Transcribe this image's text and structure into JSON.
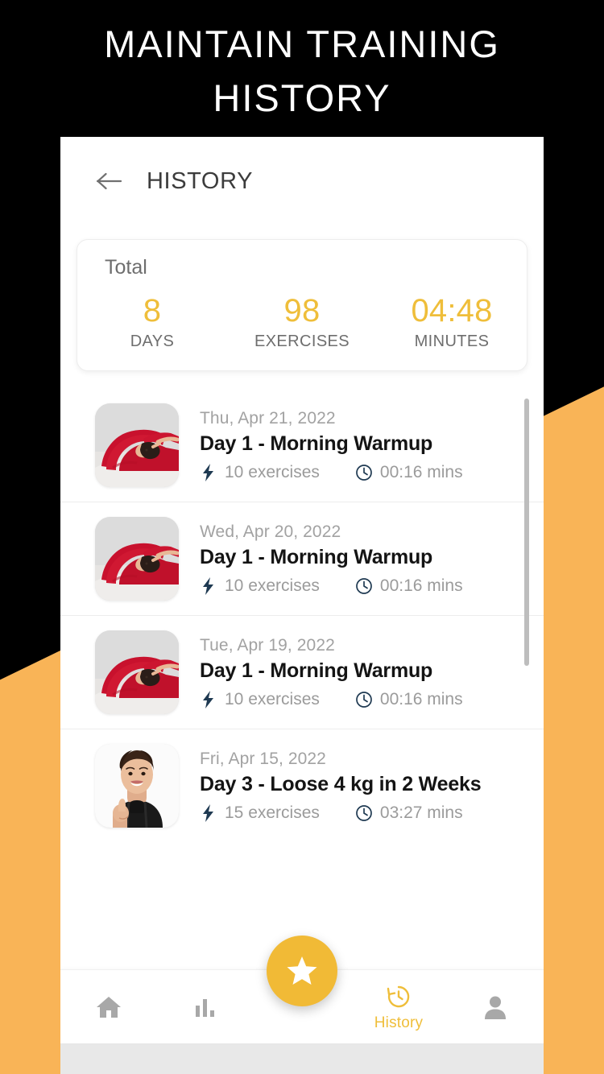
{
  "promo": {
    "headline": "MAINTAIN TRAINING\nHISTORY",
    "background_color": "#000000",
    "accent_color": "#F9B457"
  },
  "theme": {
    "amber": "#EFBE3A",
    "fab": "#F1BA36",
    "icon_navy": "#1F3A52",
    "muted_text": "#9B9B9B"
  },
  "appbar": {
    "back_icon": "arrow-left-icon",
    "title": "HISTORY"
  },
  "total_card": {
    "label": "Total",
    "stats": [
      {
        "value": "8",
        "unit": "DAYS"
      },
      {
        "value": "98",
        "unit": "EXERCISES"
      },
      {
        "value": "04:48",
        "unit": "MINUTES"
      }
    ]
  },
  "history": {
    "rows": [
      {
        "date": "Thu, Apr 21, 2022",
        "title": "Day 1 - Morning Warmup",
        "exercises": "10 exercises",
        "duration": "00:16 mins",
        "thumb": "woman-side-stretch-red",
        "exercises_icon": "lightning-bolt-icon",
        "duration_icon": "clock-icon"
      },
      {
        "date": "Wed, Apr 20, 2022",
        "title": "Day 1 - Morning Warmup",
        "exercises": "10 exercises",
        "duration": "00:16 mins",
        "thumb": "woman-side-stretch-red",
        "exercises_icon": "lightning-bolt-icon",
        "duration_icon": "clock-icon"
      },
      {
        "date": "Tue, Apr 19, 2022",
        "title": "Day 1 - Morning Warmup",
        "exercises": "10 exercises",
        "duration": "00:16 mins",
        "thumb": "woman-side-stretch-red",
        "exercises_icon": "lightning-bolt-icon",
        "duration_icon": "clock-icon"
      },
      {
        "date": "Fri, Apr 15, 2022",
        "title": "Day 3 - Loose 4 kg in 2 Weeks",
        "exercises": "15 exercises",
        "duration": "03:27 mins",
        "thumb": "woman-thumbs-up",
        "exercises_icon": "lightning-bolt-icon",
        "duration_icon": "clock-icon"
      }
    ]
  },
  "bottom_nav": {
    "items": [
      {
        "icon": "home-icon",
        "label": "",
        "active": false
      },
      {
        "icon": "bar-chart-icon",
        "label": "",
        "active": false
      },
      {
        "icon": "history-icon",
        "label": "History",
        "active": true
      },
      {
        "icon": "person-icon",
        "label": "",
        "active": false
      }
    ],
    "fab_icon": "star-icon"
  }
}
